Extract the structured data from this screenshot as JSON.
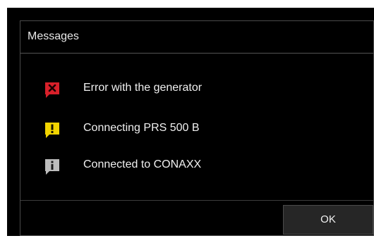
{
  "dialog": {
    "title": "Messages"
  },
  "messages": [
    {
      "icon": "error-icon",
      "text": "Error with the generator",
      "color": "#d8202a"
    },
    {
      "icon": "warning-icon",
      "text": "Connecting PRS 500 B",
      "color": "#f2d400"
    },
    {
      "icon": "info-icon",
      "text": "Connected to CONAXX",
      "color": "#bdbdbd"
    }
  ],
  "footer": {
    "ok_label": "OK"
  }
}
